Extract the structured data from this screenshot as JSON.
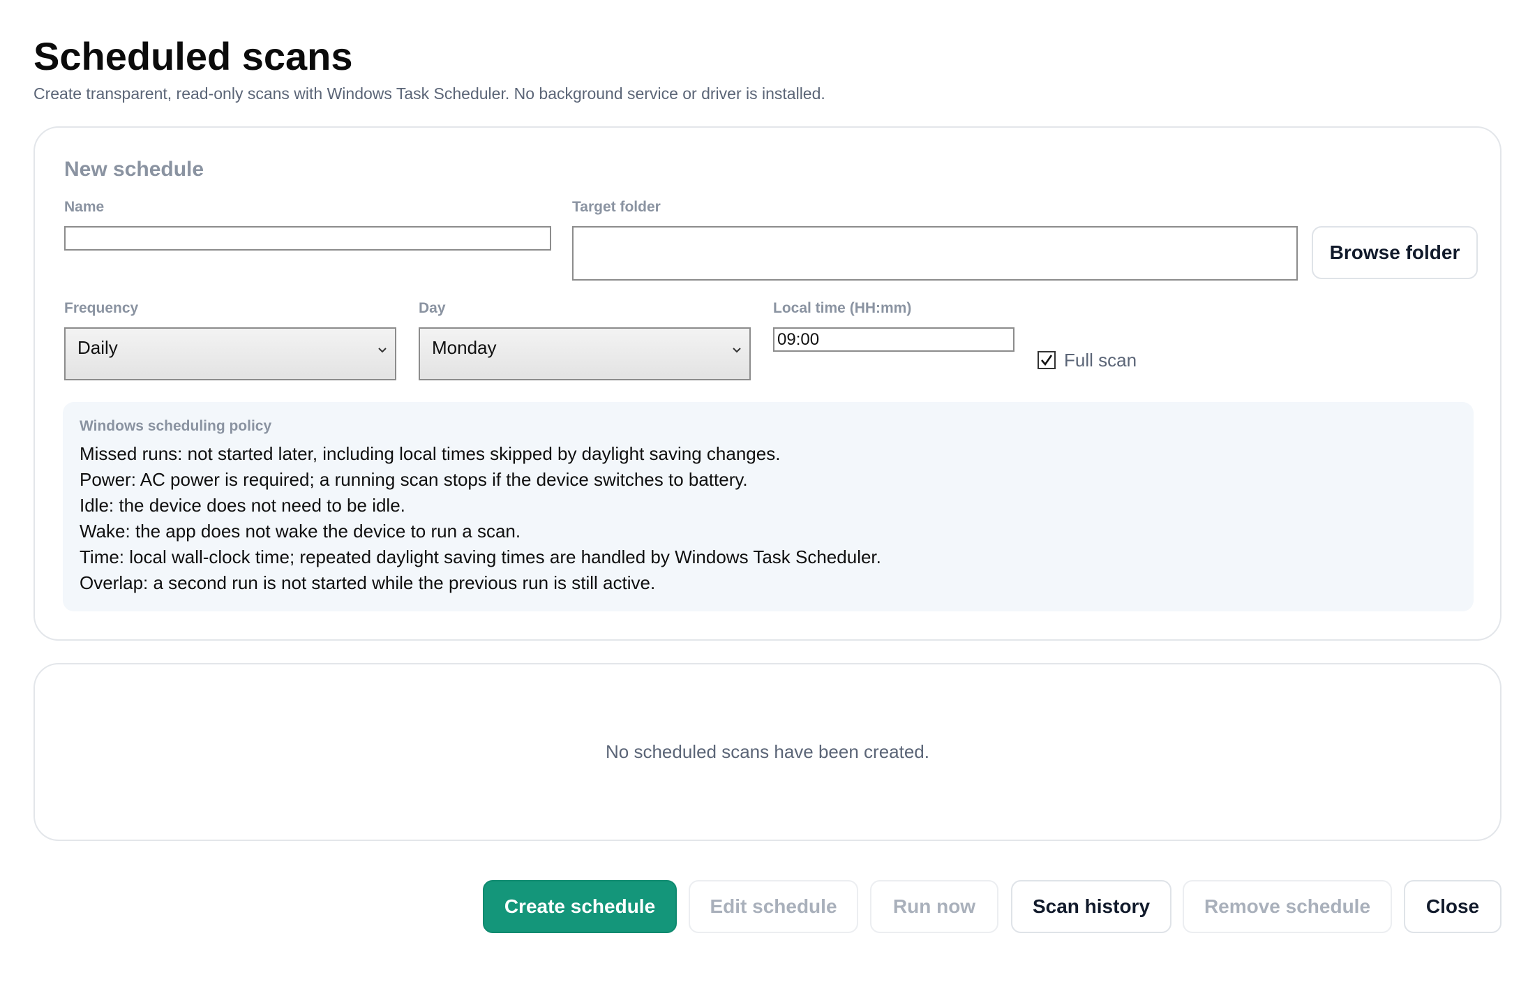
{
  "header": {
    "title": "Scheduled scans",
    "subtitle": "Create transparent, read-only scans with Windows Task Scheduler. No background service or driver is installed."
  },
  "new_schedule": {
    "section_title": "New schedule",
    "name_label": "Name",
    "name_value": "",
    "target_folder_label": "Target folder",
    "target_folder_value": "",
    "browse_folder_label": "Browse folder",
    "frequency_label": "Frequency",
    "frequency_value": "Daily",
    "day_label": "Day",
    "day_value": "Monday",
    "local_time_label": "Local time (HH:mm)",
    "local_time_value": "09:00",
    "full_scan_label": "Full scan",
    "full_scan_checked": true
  },
  "policy": {
    "title": "Windows scheduling policy",
    "lines": [
      "Missed runs: not started later, including local times skipped by daylight saving changes.",
      "Power: AC power is required; a running scan stops if the device switches to battery.",
      "Idle: the device does not need to be idle.",
      "Wake: the app does not wake the device to run a scan.",
      "Time: local wall-clock time; repeated daylight saving times are handled by Windows Task Scheduler.",
      "Overlap: a second run is not started while the previous run is still active."
    ]
  },
  "schedule_list": {
    "empty_message": "No scheduled scans have been created."
  },
  "actions": {
    "create_schedule": "Create schedule",
    "edit_schedule": "Edit schedule",
    "run_now": "Run now",
    "scan_history": "Scan history",
    "remove_schedule": "Remove schedule",
    "close": "Close"
  },
  "colors": {
    "primary": "#14967a",
    "muted_text": "#8a93a1",
    "subtitle_text": "#5b6577",
    "policy_background": "#f3f7fb"
  }
}
